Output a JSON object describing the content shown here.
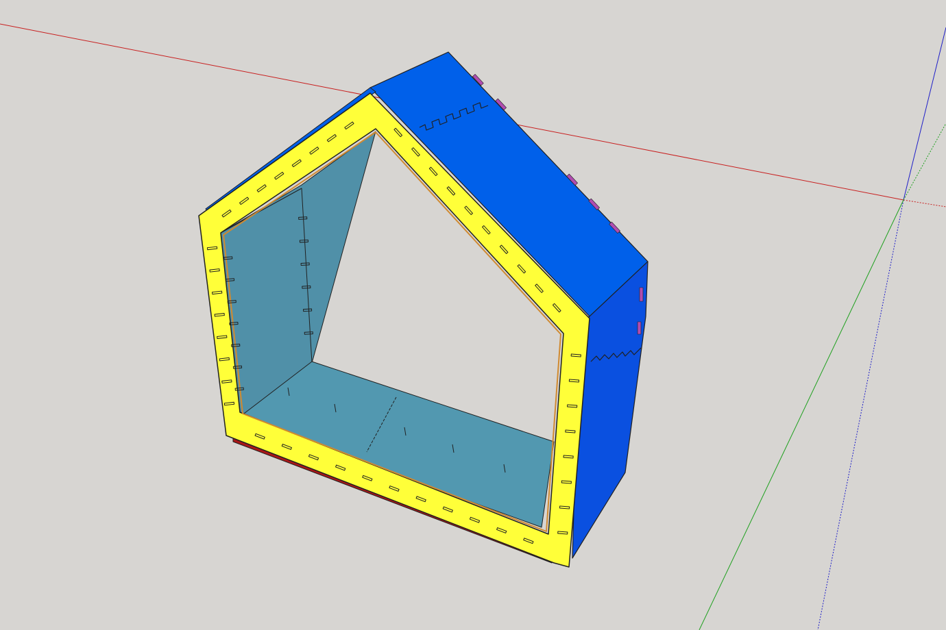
{
  "viewport": {
    "background": "#d7d5d2",
    "axis_colors": {
      "x": "#c81e1e",
      "y": "#1ea01e",
      "z": "#1e1ec8"
    }
  },
  "model": {
    "colors": {
      "front_face": "#ffff39",
      "roof_top": "#0060ea",
      "right_side": "#0a50e0",
      "back_interior": "#5090a8",
      "floor_interior": "#5298b0",
      "base_strip": "#a81818",
      "edge_accent": "#b04db0",
      "outline": "#202020"
    }
  }
}
